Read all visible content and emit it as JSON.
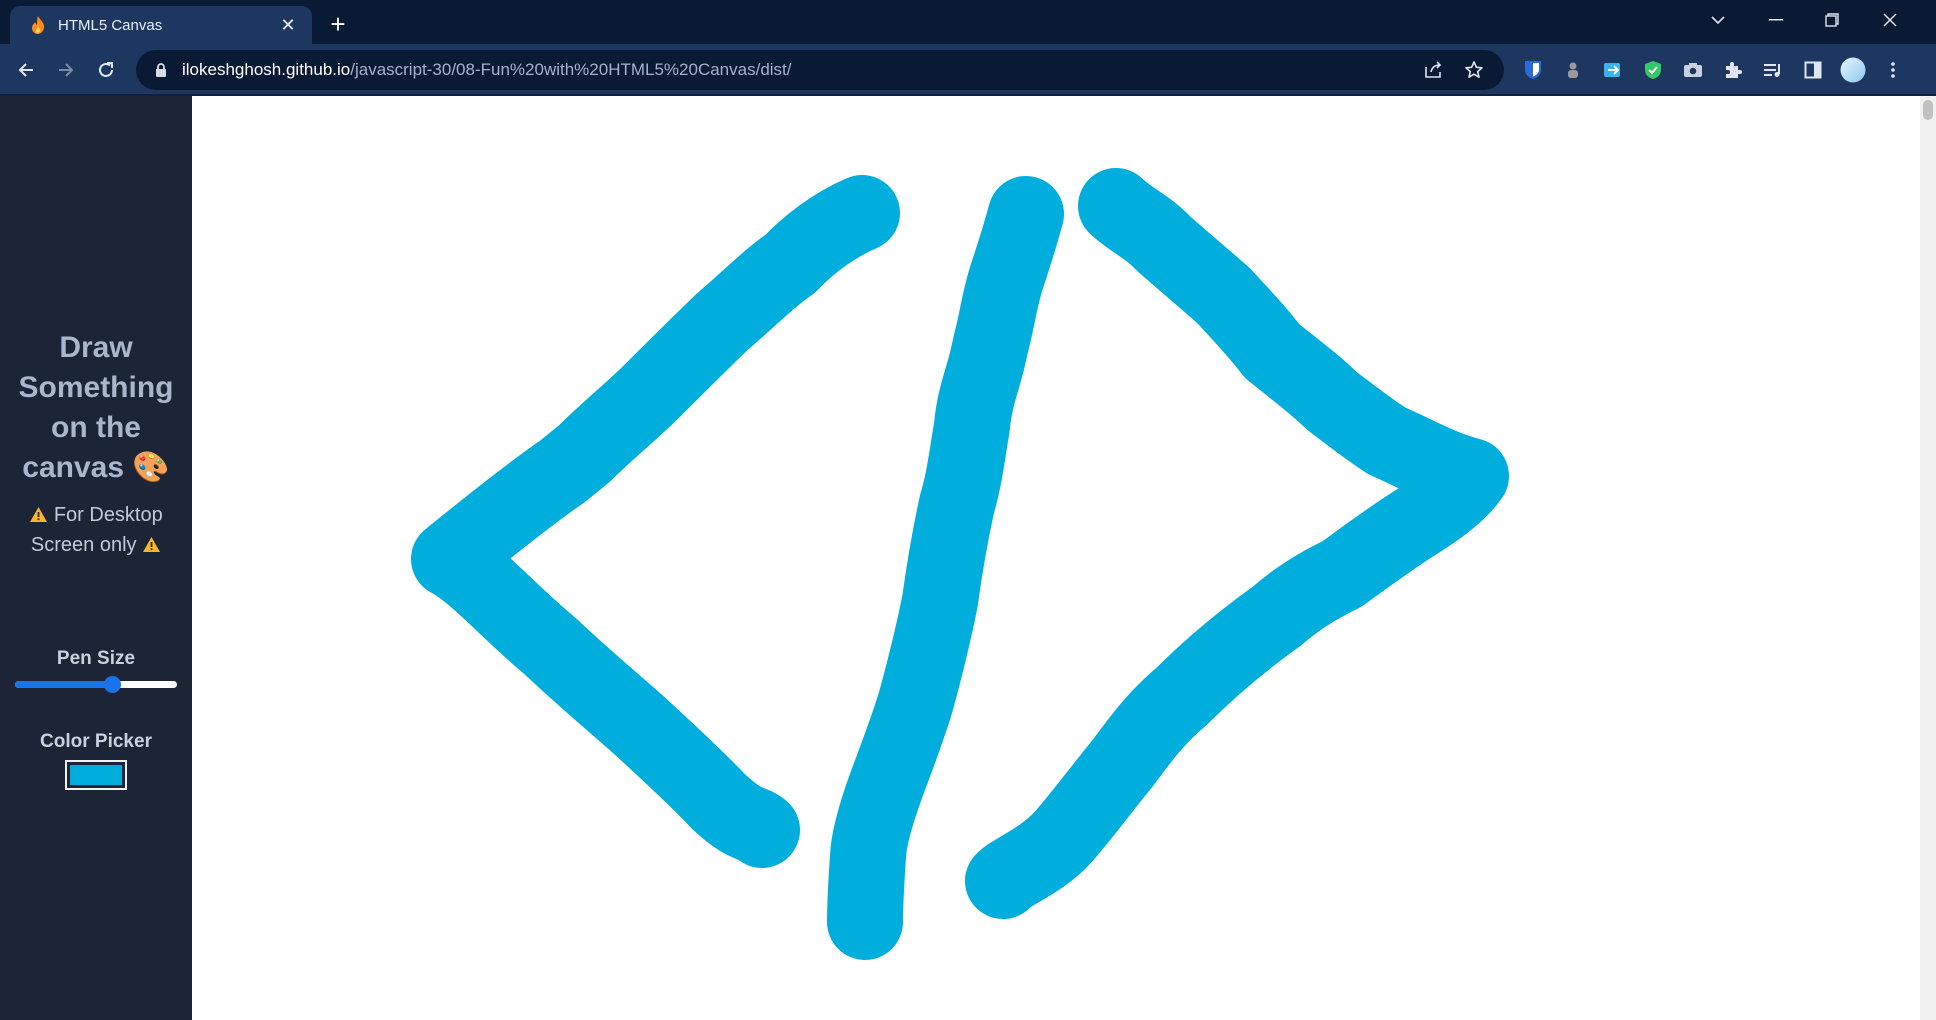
{
  "browser": {
    "tab_title": "HTML5 Canvas",
    "url_host": "ilokeshghosh.github.io",
    "url_path": "/javascript-30/08-Fun%20with%20HTML5%20Canvas/dist/",
    "new_tab_glyph": "+",
    "close_glyph": "✕",
    "extensions": [
      "bitwarden-icon",
      "ext-person-icon",
      "ext-share-icon",
      "shield-check-icon",
      "camera-icon",
      "puzzle-icon",
      "media-queue-icon",
      "side-panel-icon",
      "profile-avatar-icon",
      "menu-icon"
    ]
  },
  "sidebar": {
    "heading": "Draw Something on the canvas",
    "heading_emoji": "🎨",
    "note": "For Desktop Screen only",
    "pen_size_label": "Pen Size",
    "pen_size_fraction": 0.6,
    "color_picker_label": "Color Picker",
    "color_value": "#00aedd"
  },
  "canvas": {
    "background": "#ffffff",
    "stroke_color": "#00aedd"
  }
}
